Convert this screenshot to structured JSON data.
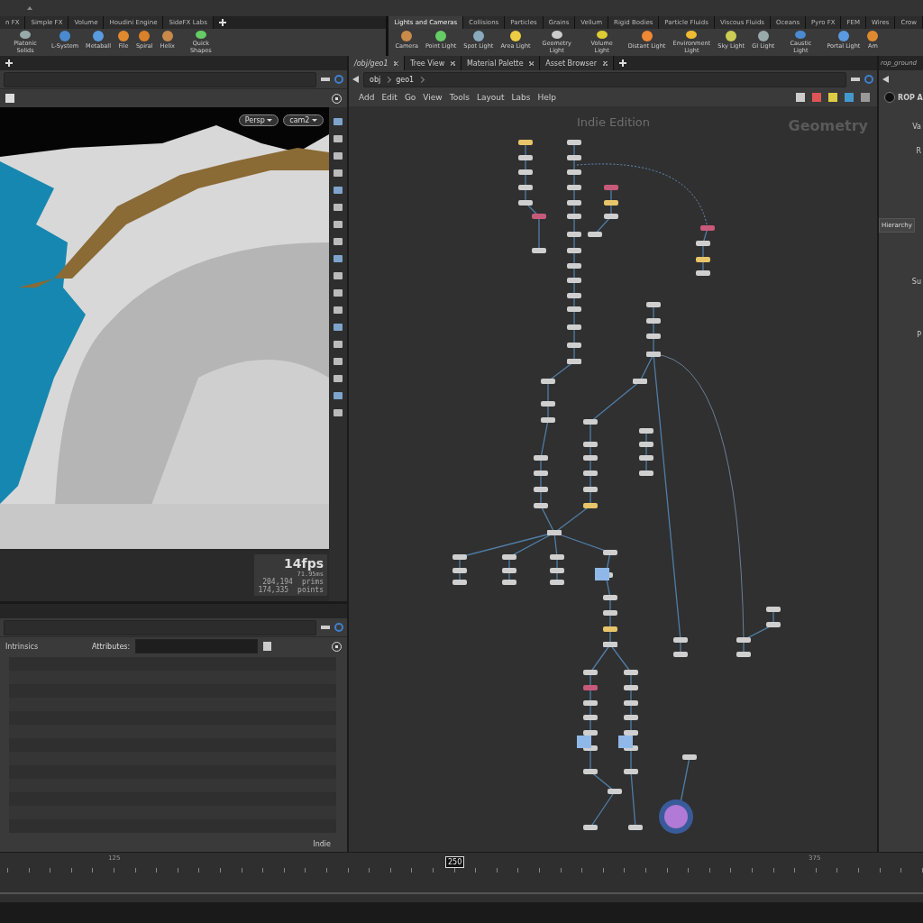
{
  "shelf_left": {
    "tabs": [
      {
        "label": "n FX",
        "selected": false
      },
      {
        "label": "Simple FX",
        "selected": false
      },
      {
        "label": "Volume",
        "selected": false
      },
      {
        "label": "Houdini Engine",
        "selected": false
      },
      {
        "label": "SideFX Labs",
        "selected": false
      }
    ],
    "tools": [
      "Platonic Solids",
      "L-System",
      "Metaball",
      "File",
      "Spiral",
      "Helix",
      "Quick Shapes"
    ]
  },
  "shelf_right": {
    "tabs": [
      {
        "label": "Lights and Cameras",
        "selected": true
      },
      {
        "label": "Collisions",
        "selected": false
      },
      {
        "label": "Particles",
        "selected": false
      },
      {
        "label": "Grains",
        "selected": false
      },
      {
        "label": "Vellum",
        "selected": false
      },
      {
        "label": "Rigid Bodies",
        "selected": false
      },
      {
        "label": "Particle Fluids",
        "selected": false
      },
      {
        "label": "Viscous Fluids",
        "selected": false
      },
      {
        "label": "Oceans",
        "selected": false
      },
      {
        "label": "Pyro FX",
        "selected": false
      },
      {
        "label": "FEM",
        "selected": false
      },
      {
        "label": "Wires",
        "selected": false
      },
      {
        "label": "Crow",
        "selected": false
      }
    ],
    "tools": [
      "Camera",
      "Point Light",
      "Spot Light",
      "Area Light",
      "Geometry Light",
      "Volume Light",
      "Distant Light",
      "Environment Light",
      "Sky Light",
      "GI Light",
      "Caustic Light",
      "Portal Light",
      "Am"
    ]
  },
  "viewport": {
    "view_menu": "Persp",
    "camera_menu": "cam2",
    "fps": "14fps",
    "frame_time": "71.95ms",
    "prims_count": "204,194",
    "prims_label": "prims",
    "points_count": "174,335",
    "points_label": "points"
  },
  "spreadsheet": {
    "tab": "Intrinsics",
    "attributes_label": "Attributes:",
    "status": "Indie"
  },
  "network": {
    "tabs": [
      {
        "label": "/obj/geo1",
        "selected": true
      },
      {
        "label": "Tree View",
        "selected": false
      },
      {
        "label": "Material Palette",
        "selected": false
      },
      {
        "label": "Asset Browser",
        "selected": false
      }
    ],
    "path": [
      "obj",
      "geo1"
    ],
    "menu": [
      "Add",
      "Edit",
      "Go",
      "View",
      "Tools",
      "Layout",
      "Labs",
      "Help"
    ],
    "edition": "Indie Edition",
    "context": "Geometry"
  },
  "parameters": {
    "tab": "rop_ground",
    "node_type": "ROP A",
    "labels": [
      "Va",
      "R"
    ],
    "hierarchy_button": "Hierarchy",
    "labels_lower": [
      "Su",
      "P"
    ]
  },
  "timeline": {
    "ticks": [
      "125",
      "375"
    ],
    "current_frame": "250"
  }
}
